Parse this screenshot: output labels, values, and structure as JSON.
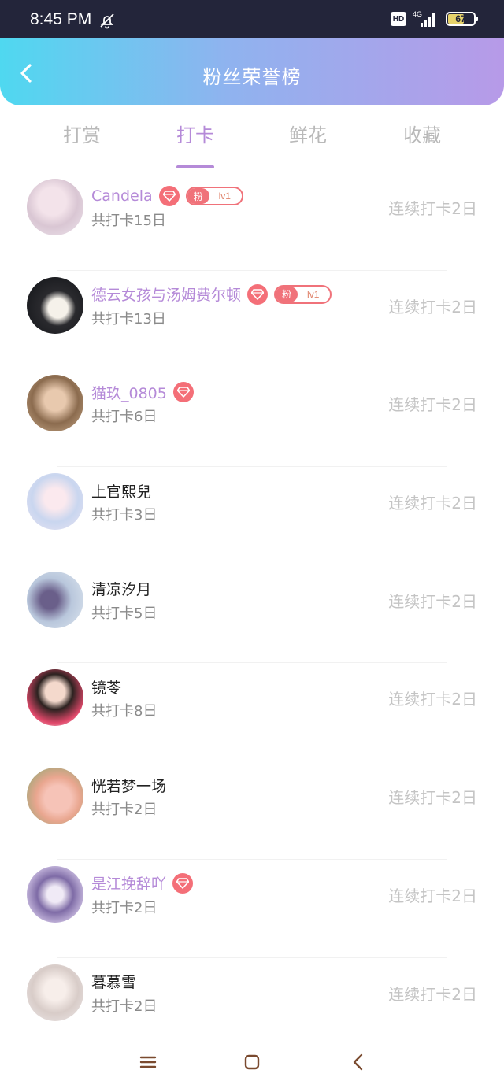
{
  "status_bar": {
    "time": "8:45 PM",
    "hd_label": "HD",
    "network": "4G",
    "battery": "67"
  },
  "header": {
    "title": "粉丝荣誉榜",
    "back_icon": "chevron-left-icon"
  },
  "tabs": [
    {
      "label": "打赏",
      "active": false
    },
    {
      "label": "打卡",
      "active": true
    },
    {
      "label": "鲜花",
      "active": false
    },
    {
      "label": "收藏",
      "active": false
    }
  ],
  "colors": {
    "accent": "#b58ad8",
    "badge": "#f46f78",
    "header_start": "#4fd8f0",
    "header_end": "#b79ae8"
  },
  "fan_badge": {
    "label": "粉",
    "level": "lv1"
  },
  "rows": [
    {
      "name": "Candela",
      "vip": true,
      "gem": true,
      "fan_badge": true,
      "total": "共打卡15日",
      "streak": "连续打卡2日"
    },
    {
      "name": "德云女孩与汤姆费尔顿",
      "vip": true,
      "gem": true,
      "fan_badge": true,
      "total": "共打卡13日",
      "streak": "连续打卡2日"
    },
    {
      "name": "猫玖_0805",
      "vip": true,
      "gem": true,
      "fan_badge": false,
      "total": "共打卡6日",
      "streak": "连续打卡2日"
    },
    {
      "name": "上官熙兒",
      "vip": false,
      "gem": false,
      "fan_badge": false,
      "total": "共打卡3日",
      "streak": "连续打卡2日"
    },
    {
      "name": "清凉汐月",
      "vip": false,
      "gem": false,
      "fan_badge": false,
      "total": "共打卡5日",
      "streak": "连续打卡2日"
    },
    {
      "name": "镜苓",
      "vip": false,
      "gem": false,
      "fan_badge": false,
      "total": "共打卡8日",
      "streak": "连续打卡2日"
    },
    {
      "name": "恍若梦一场",
      "vip": false,
      "gem": false,
      "fan_badge": false,
      "total": "共打卡2日",
      "streak": "连续打卡2日"
    },
    {
      "name": "是江挽辞吖",
      "vip": true,
      "gem": true,
      "fan_badge": false,
      "total": "共打卡2日",
      "streak": "连续打卡2日"
    },
    {
      "name": "暮慕雪",
      "vip": false,
      "gem": false,
      "fan_badge": false,
      "total": "共打卡2日",
      "streak": "连续打卡2日"
    }
  ],
  "nav": {
    "menu_icon": "menu-icon",
    "home_icon": "home-square-icon",
    "back_icon": "back-triangle-icon"
  }
}
